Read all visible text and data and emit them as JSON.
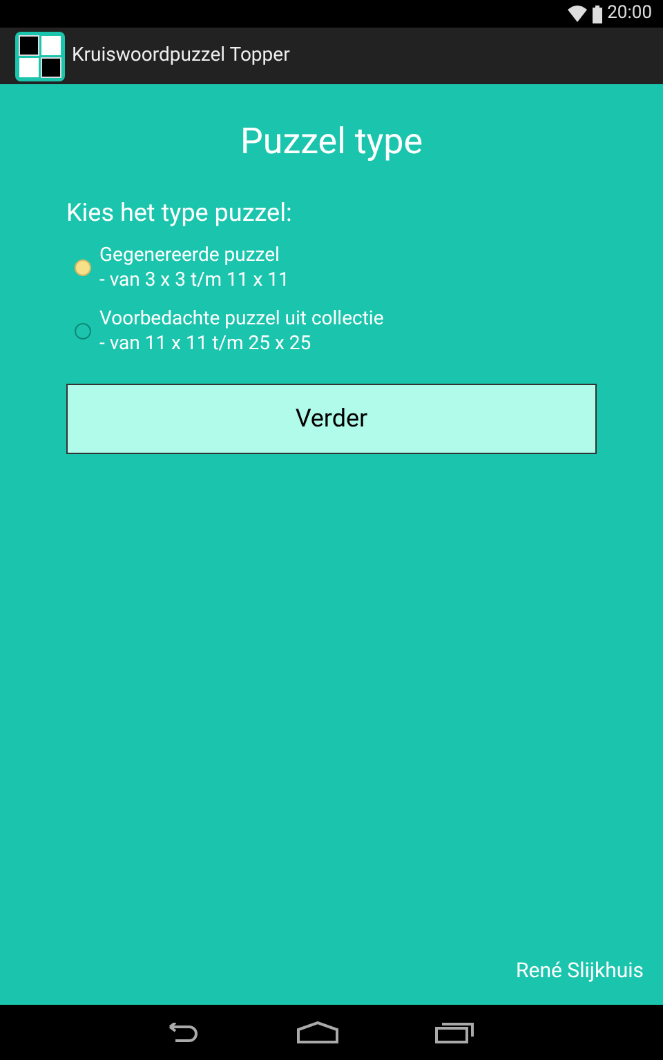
{
  "status_bar": {
    "time": "20:00"
  },
  "action_bar": {
    "title": "Kruiswoordpuzzel Topper"
  },
  "heading": "Puzzel type",
  "prompt": "Kies het type puzzel:",
  "options": [
    {
      "label": "Gegenereerde puzzel",
      "detail": "- van 3 x 3 t/m 11 x 11",
      "selected": true
    },
    {
      "label": "Voorbedachte puzzel uit collectie",
      "detail": "- van 11 x 11 t/m 25 x 25",
      "selected": false
    }
  ],
  "button": "Verder",
  "author": "René Slijkhuis"
}
